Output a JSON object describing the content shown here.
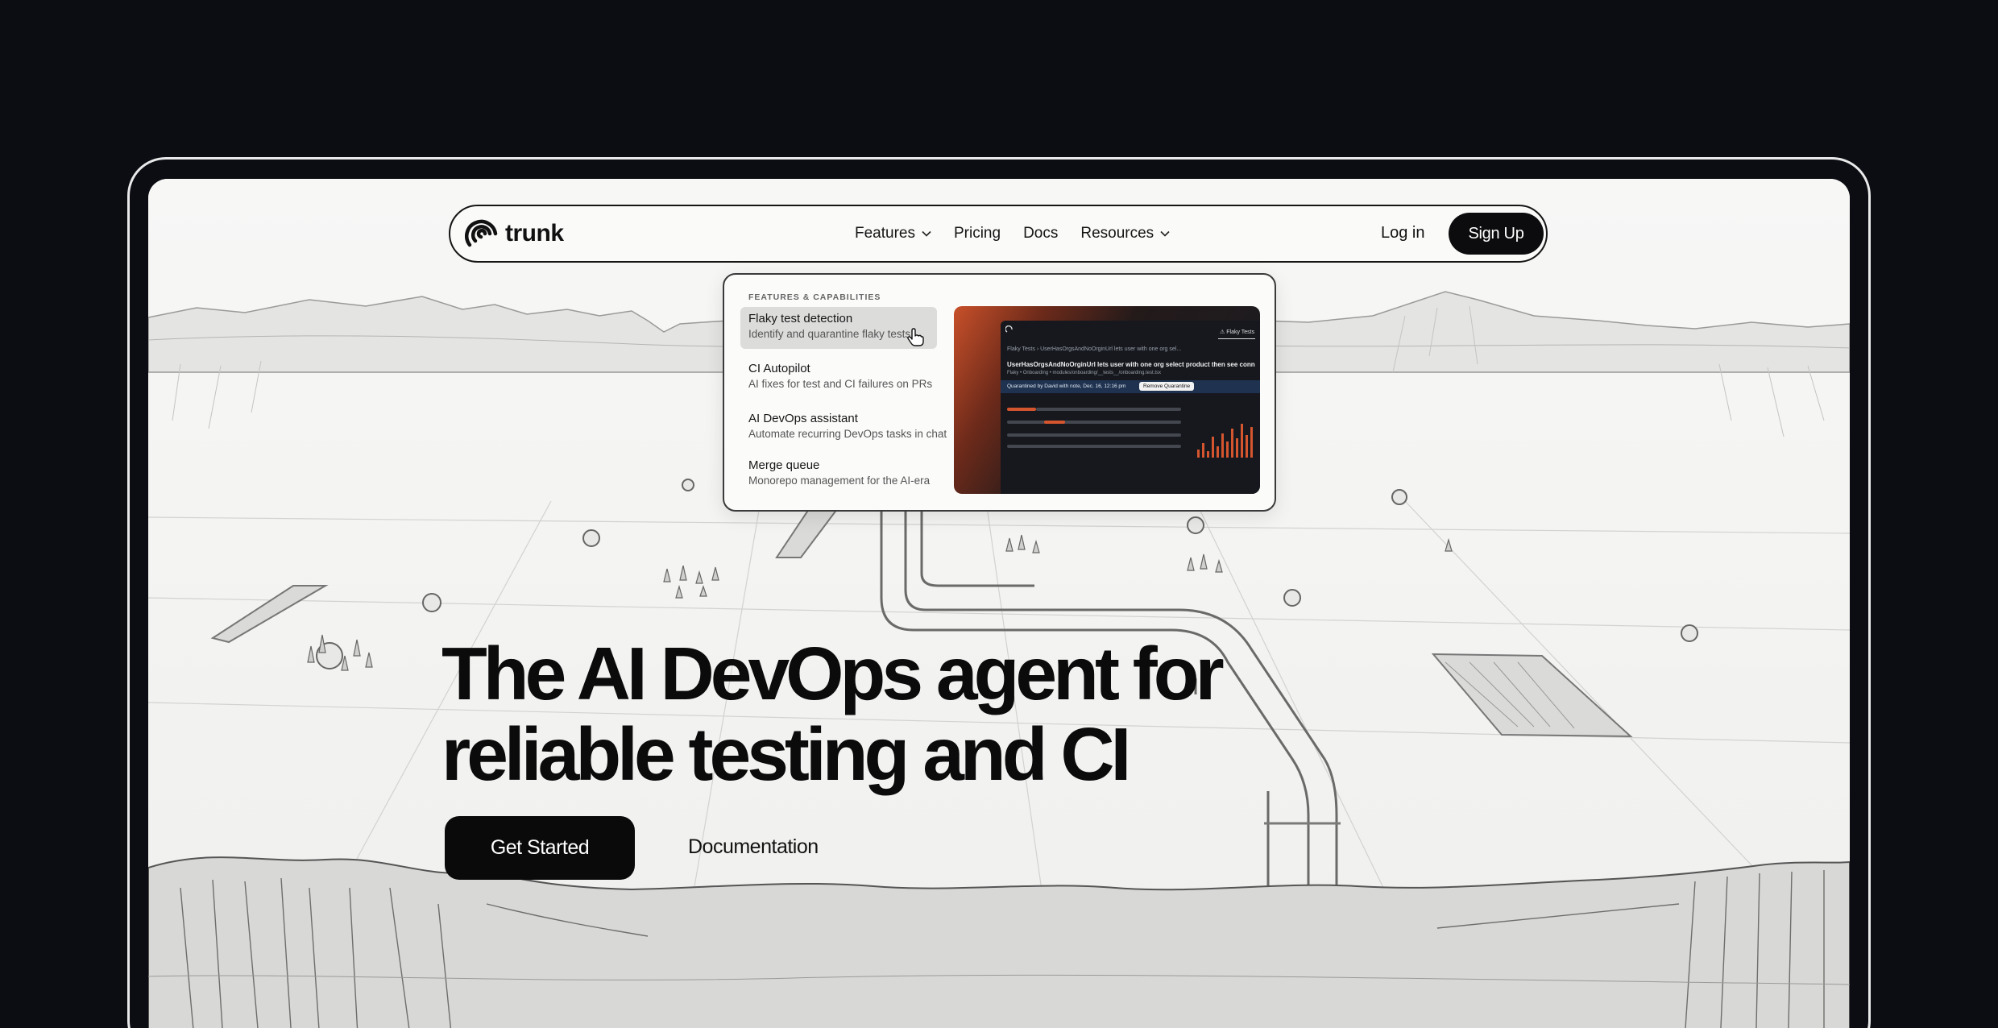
{
  "nav": {
    "brand": "trunk",
    "links": [
      {
        "label": "Features",
        "has_dropdown": true
      },
      {
        "label": "Pricing",
        "has_dropdown": false
      },
      {
        "label": "Docs",
        "has_dropdown": false
      },
      {
        "label": "Resources",
        "has_dropdown": true
      }
    ],
    "login": "Log in",
    "signup": "Sign Up"
  },
  "dropdown": {
    "heading": "FEATURES & CAPABILITIES",
    "items": [
      {
        "title": "Flaky test detection",
        "desc": "Identify and quarantine flaky tests"
      },
      {
        "title": "CI Autopilot",
        "desc": "AI fixes for test and CI failures on PRs"
      },
      {
        "title": "AI DevOps assistant",
        "desc": "Automate recurring DevOps tasks in chat"
      },
      {
        "title": "Merge queue",
        "desc": "Monorepo management for the AI-era"
      }
    ],
    "preview": {
      "tab": "Flaky Tests",
      "breadcrumb": "Flaky Tests  ›  UserHasOrgsAndNoOrginUrl lets user with one org sel...",
      "test_name": "UserHasOrgsAndNoOrginUrl lets user with one org select product then see conn",
      "test_meta": "Flaky  •  Onboarding  •  modules/onboarding/__tests__/onboarding.test.tsx",
      "quarantine_note": "Quarantined by David with note, Dec. 16, 12:16 pm",
      "quarantine_button": "Remove Quarantine"
    }
  },
  "hero": {
    "title_line1": "The AI DevOps agent for",
    "title_line2": "reliable testing and CI",
    "primary_cta": "Get Started",
    "secondary_cta": "Documentation"
  },
  "colors": {
    "page_bg": "#0b0d13",
    "screen_bg": "#f5f5f3",
    "button_dark": "#0a0a0b",
    "preview_accent": "#d4552e"
  }
}
